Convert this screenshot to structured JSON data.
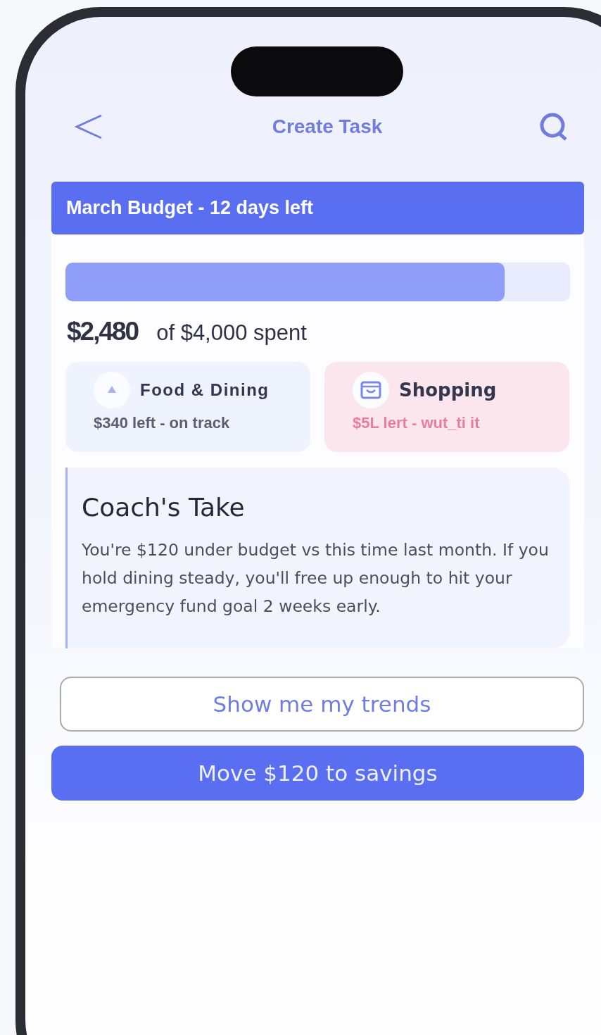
{
  "header": {
    "title": "Create Task"
  },
  "budget": {
    "title": "March Budget - 12 days left",
    "level": 0.87,
    "spent": "$2,480",
    "total": "of $4,000 spent"
  },
  "categories": [
    {
      "name": "Food & Dining",
      "status": "$340 left - on track",
      "kind": "ok"
    },
    {
      "name": "Shopping",
      "status": "$5L lert - wut_ti it",
      "kind": "warn"
    }
  ],
  "coach": {
    "title": "Coach's Take",
    "text": "You're $120 under budget vs this time last month. If you hold dining steady, you'll free up enough to hit your emergency fund goal 2 weeks early."
  },
  "buttons": [
    {
      "label": "Show me my trends",
      "kind": "secondary"
    },
    {
      "label": "Move $120 to savings",
      "kind": "primary"
    }
  ]
}
